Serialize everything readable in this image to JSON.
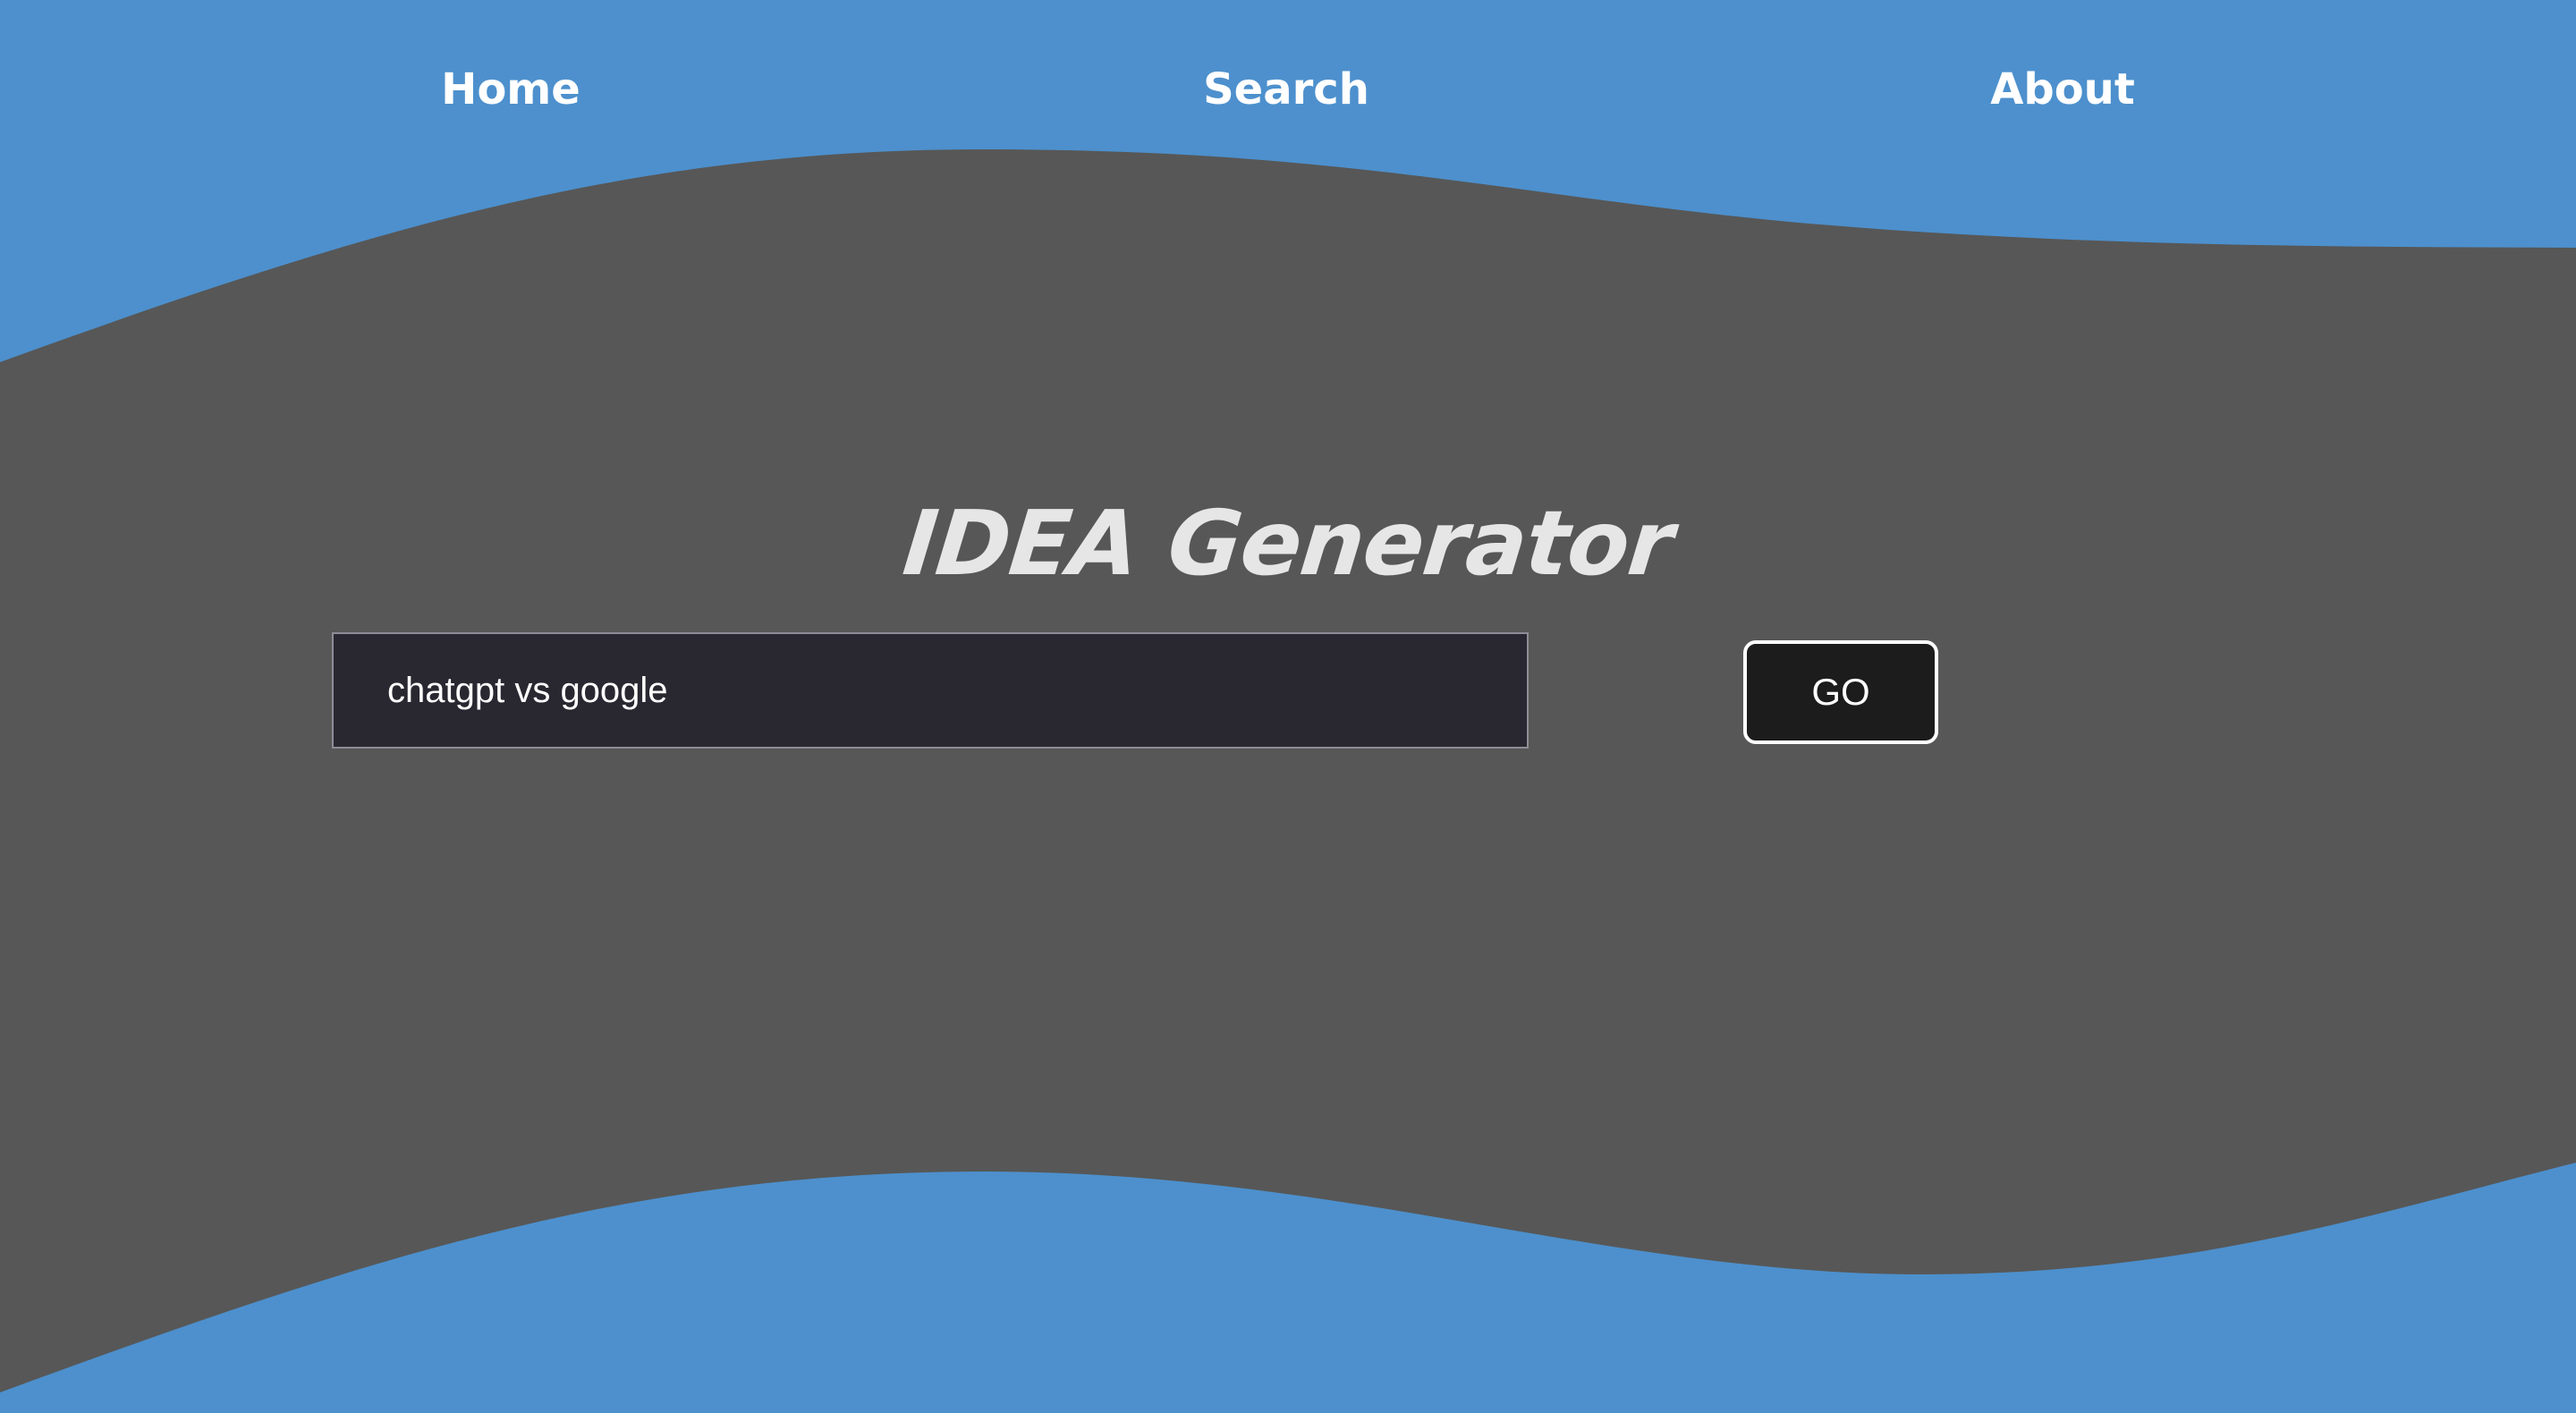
{
  "nav": {
    "items": [
      {
        "label": "Home"
      },
      {
        "label": "Search"
      },
      {
        "label": "About"
      }
    ]
  },
  "hero": {
    "title": "IDEA Generator"
  },
  "search": {
    "value": "chatgpt vs google",
    "button_label": "GO"
  },
  "colors": {
    "background": "#575757",
    "wave": "#4d90cd",
    "input_bg": "#292831",
    "button_bg": "#1c1c1c",
    "title": "#e6e6e6",
    "nav_text": "#ffffff"
  }
}
